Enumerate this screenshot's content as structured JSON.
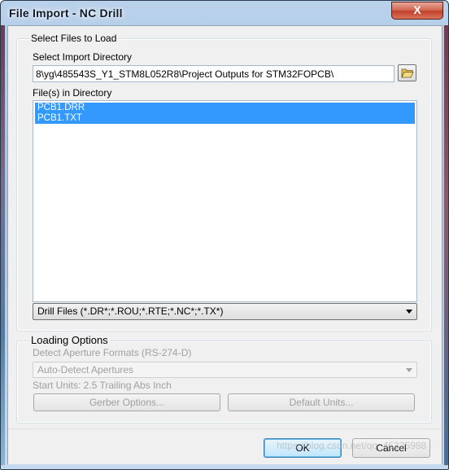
{
  "window": {
    "title": "File Import - NC Drill",
    "close_glyph": "X"
  },
  "select_files": {
    "group_title": "Select Files to Load",
    "dir_label": "Select Import Directory",
    "dir_value": "8\\yg\\485543S_Y1_STM8L052R8\\Project Outputs for STM32FOPCB\\",
    "browse_icon": "folder-open-icon",
    "files_label": "File(s) in Directory",
    "files": [
      "PCB1.DRR",
      "PCB1.TXT"
    ],
    "filter_value": "Drill Files (*.DR*;*.ROU;*.RTE;*.NC*;*.TX*)"
  },
  "loading_options": {
    "group_title": "Loading Options",
    "detect_label": "Detect Aperture Formats (RS-274-D)",
    "aperture_value": "Auto-Detect Apertures",
    "start_units": "Start Units: 2.5 Trailing Abs Inch",
    "gerber_options": "Gerber Options...",
    "default_units": "Default Units..."
  },
  "footer": {
    "ok": "OK",
    "cancel": "Cancel"
  },
  "watermark": "https://blog.csdn.net/qq_45325988",
  "colors": {
    "selection": "#3399ff",
    "title_text": "#0e1a2a",
    "close_button": "#c2412b"
  }
}
